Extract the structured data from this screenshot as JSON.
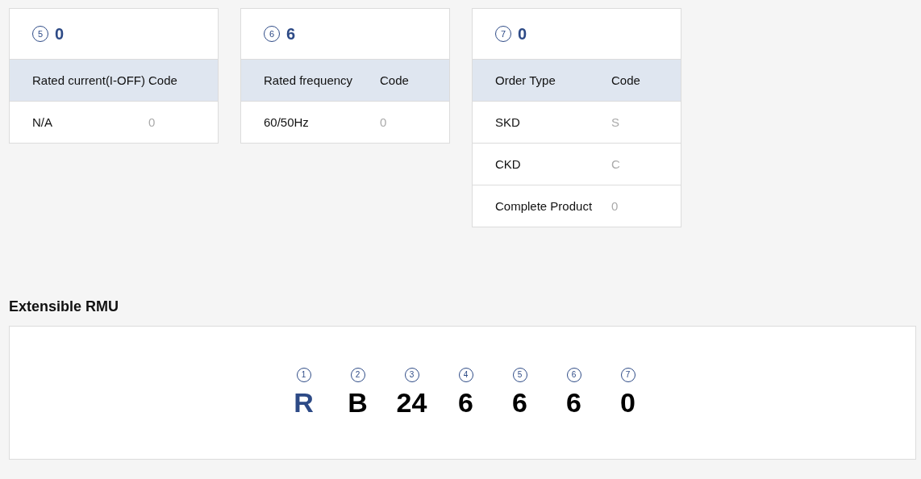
{
  "cards": [
    {
      "number": "5",
      "value": "0",
      "columns": [
        "Rated current(I-OFF)",
        "Code"
      ],
      "rows": [
        {
          "label": "N/A",
          "code": "0"
        }
      ]
    },
    {
      "number": "6",
      "value": "6",
      "columns": [
        "Rated frequency",
        "Code"
      ],
      "rows": [
        {
          "label": "60/50Hz",
          "code": "0"
        }
      ]
    },
    {
      "number": "7",
      "value": "0",
      "columns": [
        "Order Type",
        "Code"
      ],
      "rows": [
        {
          "label": "SKD",
          "code": "S"
        },
        {
          "label": "CKD",
          "code": "C"
        },
        {
          "label": "Complete Product",
          "code": "0"
        }
      ]
    }
  ],
  "section_title": "Extensible RMU",
  "code_parts": [
    {
      "number": "1",
      "value": "R",
      "highlighted": true
    },
    {
      "number": "2",
      "value": "B",
      "highlighted": false
    },
    {
      "number": "3",
      "value": "24",
      "highlighted": false
    },
    {
      "number": "4",
      "value": "6",
      "highlighted": false
    },
    {
      "number": "5",
      "value": "6",
      "highlighted": false
    },
    {
      "number": "6",
      "value": "6",
      "highlighted": false
    },
    {
      "number": "7",
      "value": "0",
      "highlighted": false
    }
  ]
}
